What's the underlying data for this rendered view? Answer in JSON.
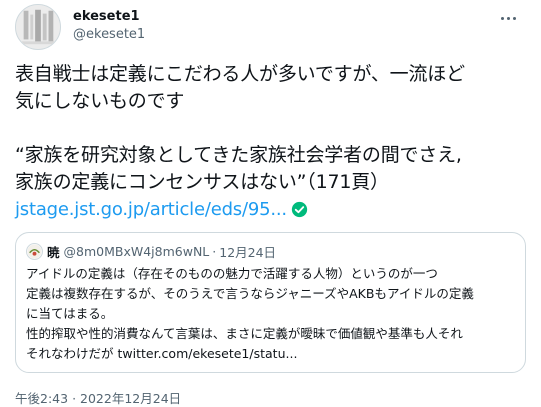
{
  "author": {
    "display_name": "ekesete1",
    "handle": "@ekesete1",
    "avatar_icon": "profile-photo"
  },
  "more_icon": "more-horizontal-icon",
  "tweet": {
    "lines": [
      "表自戦士は定義にこだわる人が多いですが、一流ほど",
      "気にしないものです",
      "",
      "“家族を研究対象としてきた家族社会学者の間でさえ,",
      "家族の定義にコンセンサスはない”（171頁）"
    ],
    "link": "jstage.jst.go.jp/article/eds/95...",
    "link_badge_icon": "verified-check-icon"
  },
  "quoted_tweet": {
    "name": "暁",
    "handle": "@8m0MBxW4j8m6wNL",
    "separator": "·",
    "date": "12月24日",
    "lines": [
      "アイドルの定義は（存在そのものの魅力で活躍する人物）というのが一つ",
      "定義は複数存在するが、そのうえで言うならジャニーズやAKBもアイドルの定義",
      "に当てはまる。",
      "性的搾取や性的消費なんて言葉は、まさに定義が曖昧で価値観や基準も人それ",
      "それなわけだが"
    ],
    "link": "twitter.com/ekesete1/statu..."
  },
  "timestamp": {
    "time": "午後2:43",
    "separator": "·",
    "date": "2022年12月24日"
  },
  "colors": {
    "link": "#1d9bf0",
    "text": "#0f1419",
    "secondary": "#536471",
    "border": "#cfd9de"
  }
}
